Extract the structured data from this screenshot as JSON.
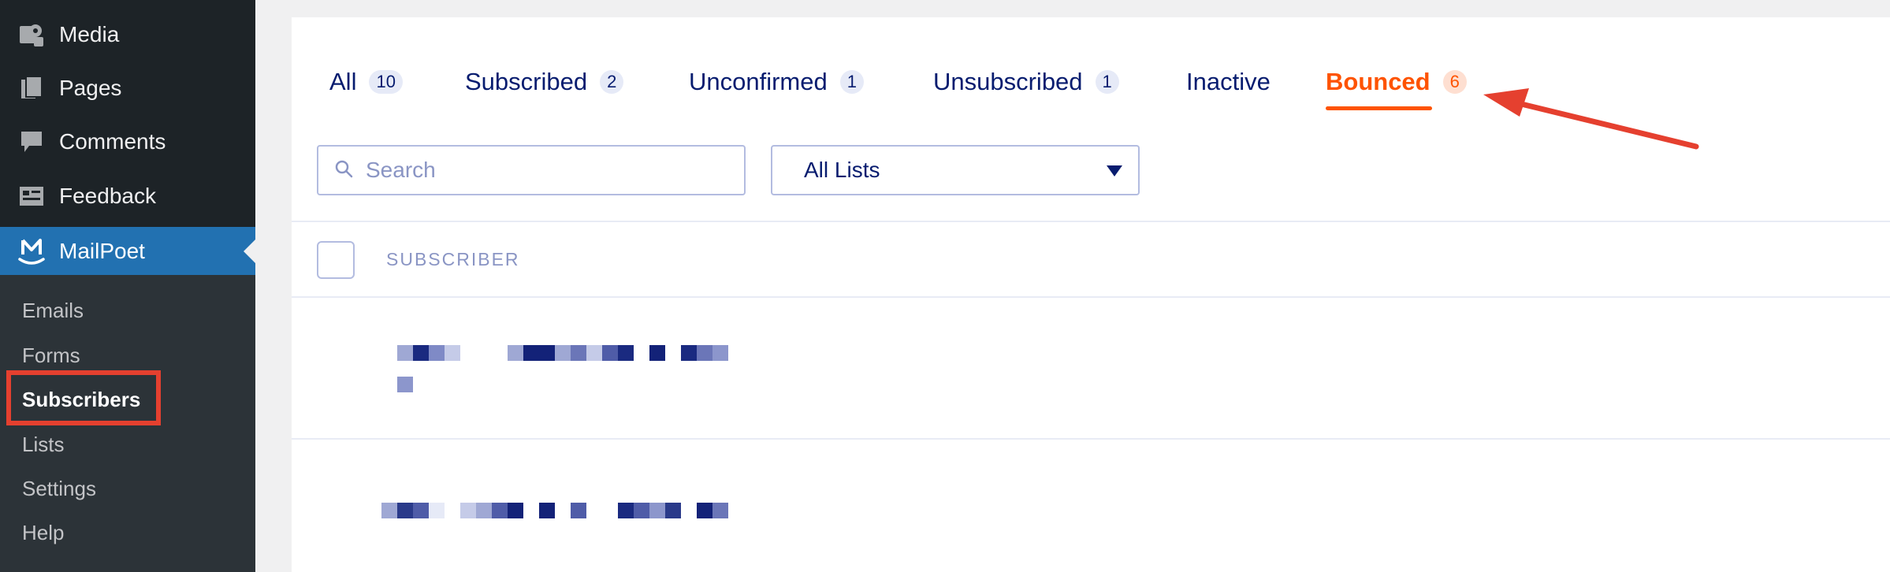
{
  "sidebar": {
    "items": [
      {
        "label": "Media",
        "icon": "media-icon"
      },
      {
        "label": "Pages",
        "icon": "pages-icon"
      },
      {
        "label": "Comments",
        "icon": "comments-icon"
      },
      {
        "label": "Feedback",
        "icon": "feedback-icon"
      },
      {
        "label": "MailPoet",
        "icon": "mailpoet-icon",
        "current": true
      }
    ],
    "submenu": [
      {
        "label": "Emails"
      },
      {
        "label": "Forms"
      },
      {
        "label": "Subscribers",
        "active": true
      },
      {
        "label": "Lists"
      },
      {
        "label": "Settings"
      },
      {
        "label": "Help"
      }
    ]
  },
  "tabs": [
    {
      "label": "All",
      "count": "10"
    },
    {
      "label": "Subscribed",
      "count": "2"
    },
    {
      "label": "Unconfirmed",
      "count": "1"
    },
    {
      "label": "Unsubscribed",
      "count": "1"
    },
    {
      "label": "Inactive",
      "count": null
    },
    {
      "label": "Bounced",
      "count": "6",
      "active": true
    }
  ],
  "filters": {
    "search_placeholder": "Search",
    "list_select_value": "All Lists"
  },
  "table": {
    "column_header": "SUBSCRIBER"
  },
  "colors": {
    "wp_sidebar": "#1d2327",
    "wp_accent": "#2271b1",
    "mailpoet_navy": "#071c6f",
    "active_tab": "#fe5301",
    "annotation_red": "#e5402f"
  }
}
